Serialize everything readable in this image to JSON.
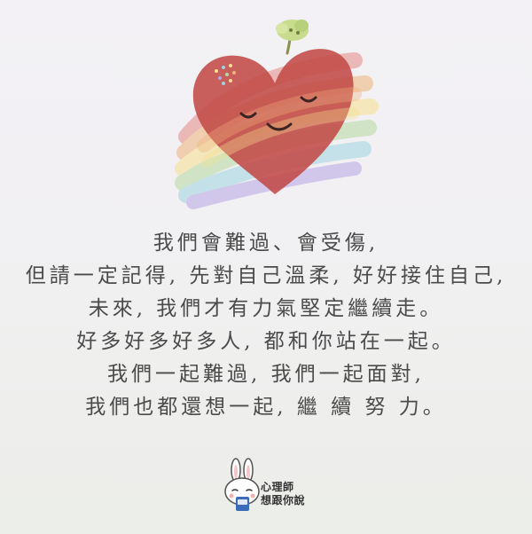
{
  "illustration": {
    "name": "rainbow-heart-illustration",
    "heart_color": "#c24a47",
    "rainbow_colors": [
      "#e48a86",
      "#f0b27a",
      "#f6e08e",
      "#b6dca0",
      "#9fd4e2",
      "#b7a6e4"
    ]
  },
  "poem": {
    "lines": [
      "我們會難過、會受傷,",
      "但請一定記得, 先對自己溫柔, 好好接住自己,",
      "未來, 我們才有力氣堅定繼續走。",
      "好多好多好多人, 都和你站在一起。",
      "我們一起難過, 我們一起面對,",
      "我們也都還想一起, 繼 續 努 力。"
    ]
  },
  "brand": {
    "line1": "心理師",
    "line2": "想跟你說",
    "icon": "rabbit-mascot-icon"
  }
}
